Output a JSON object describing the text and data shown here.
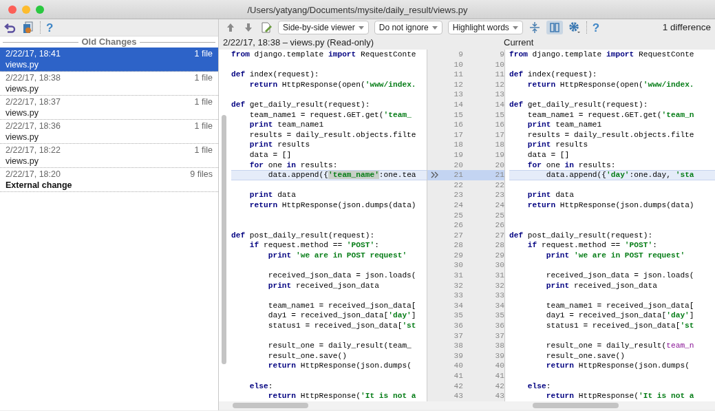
{
  "window": {
    "title": "/Users/yatyang/Documents/mysite/daily_result/views.py"
  },
  "sidebar": {
    "heading": "Old Changes",
    "items": [
      {
        "date": "2/22/17, 18:41",
        "count": "1 file",
        "name": "views.py",
        "kind": "file",
        "selected": true
      },
      {
        "date": "2/22/17, 18:38",
        "count": "1 file",
        "name": "views.py",
        "kind": "file",
        "selected": false
      },
      {
        "date": "2/22/17, 18:37",
        "count": "1 file",
        "name": "views.py",
        "kind": "file",
        "selected": false
      },
      {
        "date": "2/22/17, 18:36",
        "count": "1 file",
        "name": "views.py",
        "kind": "file",
        "selected": false
      },
      {
        "date": "2/22/17, 18:22",
        "count": "1 file",
        "name": "views.py",
        "kind": "file",
        "selected": false
      },
      {
        "date": "2/22/17, 18:20",
        "count": "9 files",
        "name": "External change",
        "kind": "external",
        "selected": false
      }
    ]
  },
  "toolbar": {
    "help_left": "?",
    "dropdowns": [
      "Side-by-side viewer",
      "Do not ignore",
      "Highlight words"
    ],
    "side_by_side_on": true,
    "help": "?",
    "difference_count": "1 difference"
  },
  "diff": {
    "left_title": "2/22/17, 18:38 – views.py (Read-only)",
    "right_title": "Current",
    "lines": [
      {
        "left_number": "9",
        "right_number": "9",
        "changed": false,
        "left": [
          {
            "text": "from ",
            "kind": "keyword"
          },
          {
            "text": "django.template ",
            "kind": "plain"
          },
          {
            "text": "import ",
            "kind": "keyword"
          },
          {
            "text": "RequestConte",
            "kind": "plain"
          }
        ],
        "right": [
          {
            "text": "from ",
            "kind": "keyword"
          },
          {
            "text": "django.template ",
            "kind": "plain"
          },
          {
            "text": "import ",
            "kind": "keyword"
          },
          {
            "text": "RequestConte",
            "kind": "plain"
          }
        ]
      },
      {
        "left_number": "10",
        "right_number": "10",
        "changed": false
      },
      {
        "left_number": "11",
        "right_number": "11",
        "changed": false,
        "left": [
          {
            "text": "def ",
            "kind": "keyword"
          },
          {
            "text": "index(request):",
            "kind": "plain"
          }
        ],
        "right": [
          {
            "text": "def ",
            "kind": "keyword"
          },
          {
            "text": "index(request):",
            "kind": "plain"
          }
        ]
      },
      {
        "left_number": "12",
        "right_number": "12",
        "changed": false,
        "left": [
          {
            "text": "    return ",
            "kind": "keyword"
          },
          {
            "text": "HttpResponse(open(",
            "kind": "plain"
          },
          {
            "text": "'www/index.",
            "kind": "string"
          }
        ],
        "right": [
          {
            "text": "    return ",
            "kind": "keyword"
          },
          {
            "text": "HttpResponse(open(",
            "kind": "plain"
          },
          {
            "text": "'www/index.",
            "kind": "string"
          }
        ]
      },
      {
        "left_number": "13",
        "right_number": "13",
        "changed": false
      },
      {
        "left_number": "14",
        "right_number": "14",
        "changed": false,
        "left": [
          {
            "text": "def ",
            "kind": "keyword"
          },
          {
            "text": "get_daily_result(request):",
            "kind": "plain"
          }
        ],
        "right": [
          {
            "text": "def ",
            "kind": "keyword"
          },
          {
            "text": "get_daily_result(request):",
            "kind": "plain"
          }
        ]
      },
      {
        "left_number": "15",
        "right_number": "15",
        "changed": false,
        "left": [
          {
            "text": "    team_name1 = request.GET.get(",
            "kind": "plain"
          },
          {
            "text": "'team_",
            "kind": "string"
          }
        ],
        "right": [
          {
            "text": "    team_name1 = request.GET.get(",
            "kind": "plain"
          },
          {
            "text": "'team_n",
            "kind": "string"
          }
        ]
      },
      {
        "left_number": "16",
        "right_number": "16",
        "changed": false,
        "left": [
          {
            "text": "    print ",
            "kind": "keyword"
          },
          {
            "text": "team_name1",
            "kind": "plain"
          }
        ],
        "right": [
          {
            "text": "    print ",
            "kind": "keyword"
          },
          {
            "text": "team_name1",
            "kind": "plain"
          }
        ]
      },
      {
        "left_number": "17",
        "right_number": "17",
        "changed": false,
        "left": [
          {
            "text": "    results = daily_result.objects.filte",
            "kind": "plain"
          }
        ],
        "right": [
          {
            "text": "    results = daily_result.objects.filte",
            "kind": "plain"
          }
        ]
      },
      {
        "left_number": "18",
        "right_number": "18",
        "changed": false,
        "left": [
          {
            "text": "    print ",
            "kind": "keyword"
          },
          {
            "text": "results",
            "kind": "plain"
          }
        ],
        "right": [
          {
            "text": "    print ",
            "kind": "keyword"
          },
          {
            "text": "results",
            "kind": "plain"
          }
        ]
      },
      {
        "left_number": "19",
        "right_number": "19",
        "changed": false,
        "left": [
          {
            "text": "    data = []",
            "kind": "plain"
          }
        ],
        "right": [
          {
            "text": "    data = []",
            "kind": "plain"
          }
        ]
      },
      {
        "left_number": "20",
        "right_number": "20",
        "changed": false,
        "left": [
          {
            "text": "    for ",
            "kind": "keyword"
          },
          {
            "text": "one ",
            "kind": "plain"
          },
          {
            "text": "in ",
            "kind": "keyword"
          },
          {
            "text": "results:",
            "kind": "plain"
          }
        ],
        "right": [
          {
            "text": "    for ",
            "kind": "keyword"
          },
          {
            "text": "one ",
            "kind": "plain"
          },
          {
            "text": "in ",
            "kind": "keyword"
          },
          {
            "text": "results:",
            "kind": "plain"
          }
        ]
      },
      {
        "left_number": "21",
        "right_number": "21",
        "changed": true,
        "left": [
          {
            "text": "        data.append({",
            "kind": "plain"
          },
          {
            "text": "'team_name'",
            "kind": "marked"
          },
          {
            "text": ":one.tea",
            "kind": "plain"
          }
        ],
        "right": [
          {
            "text": "        data.append({",
            "kind": "plain"
          },
          {
            "text": "'day'",
            "kind": "string"
          },
          {
            "text": ":one.day, ",
            "kind": "plain"
          },
          {
            "text": "'sta",
            "kind": "string"
          }
        ]
      },
      {
        "left_number": "22",
        "right_number": "22",
        "changed": false
      },
      {
        "left_number": "23",
        "right_number": "23",
        "changed": false,
        "left": [
          {
            "text": "    print ",
            "kind": "keyword"
          },
          {
            "text": "data",
            "kind": "plain"
          }
        ],
        "right": [
          {
            "text": "    print ",
            "kind": "keyword"
          },
          {
            "text": "data",
            "kind": "plain"
          }
        ]
      },
      {
        "left_number": "24",
        "right_number": "24",
        "changed": false,
        "left": [
          {
            "text": "    return ",
            "kind": "keyword"
          },
          {
            "text": "HttpResponse(json.dumps(data)",
            "kind": "plain"
          }
        ],
        "right": [
          {
            "text": "    return ",
            "kind": "keyword"
          },
          {
            "text": "HttpResponse(json.dumps(data)",
            "kind": "plain"
          }
        ]
      },
      {
        "left_number": "25",
        "right_number": "25",
        "changed": false
      },
      {
        "left_number": "26",
        "right_number": "26",
        "changed": false
      },
      {
        "left_number": "27",
        "right_number": "27",
        "changed": false,
        "left": [
          {
            "text": "def ",
            "kind": "keyword"
          },
          {
            "text": "post_daily_result(request):",
            "kind": "plain"
          }
        ],
        "right": [
          {
            "text": "def ",
            "kind": "keyword"
          },
          {
            "text": "post_daily_result(request):",
            "kind": "plain"
          }
        ]
      },
      {
        "left_number": "28",
        "right_number": "28",
        "changed": false,
        "left": [
          {
            "text": "    if ",
            "kind": "keyword"
          },
          {
            "text": "request.method == ",
            "kind": "plain"
          },
          {
            "text": "'POST'",
            "kind": "string"
          },
          {
            "text": ":",
            "kind": "plain"
          }
        ],
        "right": [
          {
            "text": "    if ",
            "kind": "keyword"
          },
          {
            "text": "request.method == ",
            "kind": "plain"
          },
          {
            "text": "'POST'",
            "kind": "string"
          },
          {
            "text": ":",
            "kind": "plain"
          }
        ]
      },
      {
        "left_number": "29",
        "right_number": "29",
        "changed": false,
        "left": [
          {
            "text": "        print ",
            "kind": "keyword"
          },
          {
            "text": "'we are in POST request'",
            "kind": "string"
          }
        ],
        "right": [
          {
            "text": "        print ",
            "kind": "keyword"
          },
          {
            "text": "'we are in POST request'",
            "kind": "string"
          }
        ]
      },
      {
        "left_number": "30",
        "right_number": "30",
        "changed": false
      },
      {
        "left_number": "31",
        "right_number": "31",
        "changed": false,
        "left": [
          {
            "text": "        received_json_data = json.loads(",
            "kind": "plain"
          }
        ],
        "right": [
          {
            "text": "        received_json_data = json.loads(",
            "kind": "plain"
          }
        ]
      },
      {
        "left_number": "32",
        "right_number": "32",
        "changed": false,
        "left": [
          {
            "text": "        print ",
            "kind": "keyword"
          },
          {
            "text": "received_json_data",
            "kind": "plain"
          }
        ],
        "right": [
          {
            "text": "        print ",
            "kind": "keyword"
          },
          {
            "text": "received_json_data",
            "kind": "plain"
          }
        ]
      },
      {
        "left_number": "33",
        "right_number": "33",
        "changed": false
      },
      {
        "left_number": "34",
        "right_number": "34",
        "changed": false,
        "left": [
          {
            "text": "        team_name1 = received_json_data[",
            "kind": "plain"
          }
        ],
        "right": [
          {
            "text": "        team_name1 = received_json_data[",
            "kind": "plain"
          }
        ]
      },
      {
        "left_number": "35",
        "right_number": "35",
        "changed": false,
        "left": [
          {
            "text": "        day1 = received_json_data[",
            "kind": "plain"
          },
          {
            "text": "'day'",
            "kind": "string"
          },
          {
            "text": "]",
            "kind": "plain"
          }
        ],
        "right": [
          {
            "text": "        day1 = received_json_data[",
            "kind": "plain"
          },
          {
            "text": "'day'",
            "kind": "string"
          },
          {
            "text": "]",
            "kind": "plain"
          }
        ]
      },
      {
        "left_number": "36",
        "right_number": "36",
        "changed": false,
        "left": [
          {
            "text": "        status1 = received_json_data[",
            "kind": "plain"
          },
          {
            "text": "'st",
            "kind": "string"
          }
        ],
        "right": [
          {
            "text": "        status1 = received_json_data[",
            "kind": "plain"
          },
          {
            "text": "'st",
            "kind": "string"
          }
        ]
      },
      {
        "left_number": "37",
        "right_number": "37",
        "changed": false
      },
      {
        "left_number": "38",
        "right_number": "38",
        "changed": false,
        "left": [
          {
            "text": "        result_one = daily_result(team_",
            "kind": "plain"
          }
        ],
        "right": [
          {
            "text": "        result_one = daily_result(",
            "kind": "plain"
          },
          {
            "text": "team_n",
            "kind": "param"
          }
        ]
      },
      {
        "left_number": "39",
        "right_number": "39",
        "changed": false,
        "left": [
          {
            "text": "        result_one.save()",
            "kind": "plain"
          }
        ],
        "right": [
          {
            "text": "        result_one.save()",
            "kind": "plain"
          }
        ]
      },
      {
        "left_number": "40",
        "right_number": "40",
        "changed": false,
        "left": [
          {
            "text": "        return ",
            "kind": "keyword"
          },
          {
            "text": "HttpResponse(json.dumps(",
            "kind": "plain"
          }
        ],
        "right": [
          {
            "text": "        return ",
            "kind": "keyword"
          },
          {
            "text": "HttpResponse(json.dumps(",
            "kind": "plain"
          }
        ]
      },
      {
        "left_number": "41",
        "right_number": "41",
        "changed": false
      },
      {
        "left_number": "42",
        "right_number": "42",
        "changed": false,
        "left": [
          {
            "text": "    else",
            "kind": "keyword"
          },
          {
            "text": ":",
            "kind": "plain"
          }
        ],
        "right": [
          {
            "text": "    else",
            "kind": "keyword"
          },
          {
            "text": ":",
            "kind": "plain"
          }
        ]
      },
      {
        "left_number": "43",
        "right_number": "43",
        "changed": false,
        "left": [
          {
            "text": "        return ",
            "kind": "keyword"
          },
          {
            "text": "HttpResponse(",
            "kind": "plain"
          },
          {
            "text": "'It is not a",
            "kind": "string"
          }
        ],
        "right": [
          {
            "text": "        return ",
            "kind": "keyword"
          },
          {
            "text": "HttpResponse(",
            "kind": "plain"
          },
          {
            "text": "'It is not a",
            "kind": "string"
          }
        ]
      }
    ]
  }
}
